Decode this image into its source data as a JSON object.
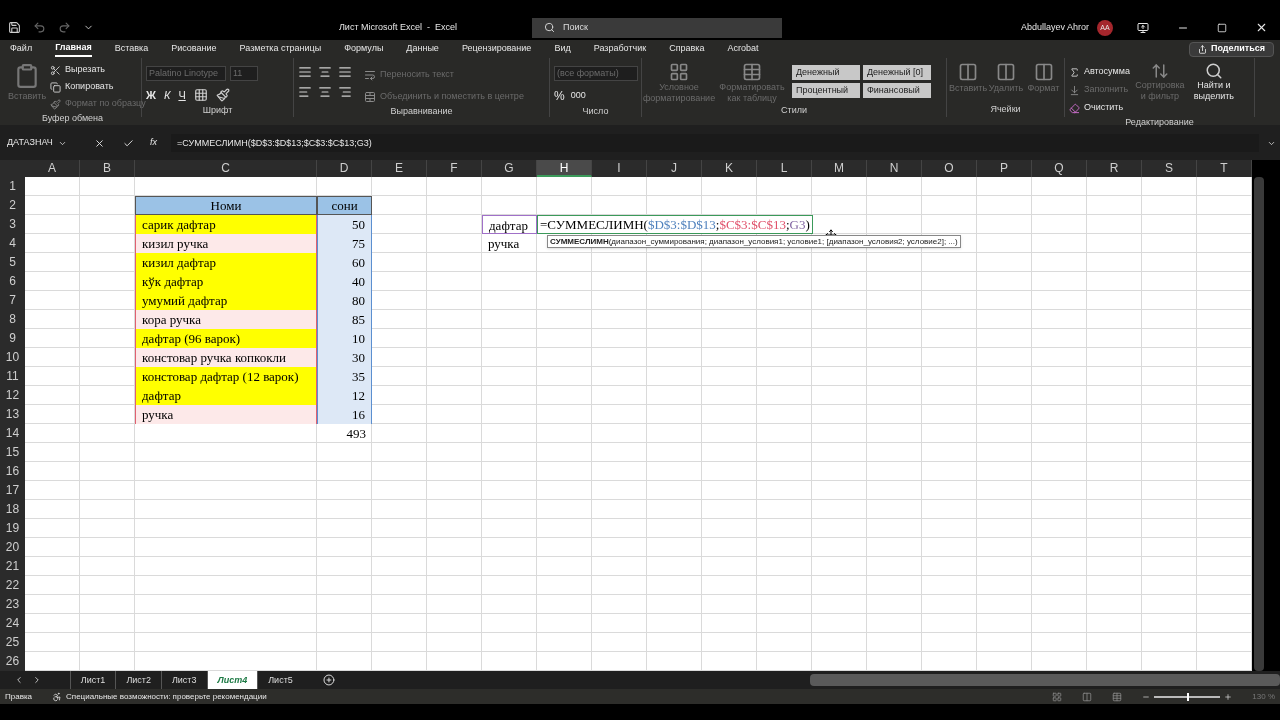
{
  "window": {
    "title": "Лист Microsoft Excel  -  Excel",
    "search_placeholder": "Поиск",
    "user": "Abdullayev Ahror",
    "avatar": "AA"
  },
  "ribbon_tabs": [
    {
      "label": "Файл",
      "selected": false
    },
    {
      "label": "Главная",
      "selected": true
    },
    {
      "label": "Вставка",
      "selected": false
    },
    {
      "label": "Рисование",
      "selected": false
    },
    {
      "label": "Разметка страницы",
      "selected": false
    },
    {
      "label": "Формулы",
      "selected": false
    },
    {
      "label": "Данные",
      "selected": false
    },
    {
      "label": "Рецензирование",
      "selected": false
    },
    {
      "label": "Вид",
      "selected": false
    },
    {
      "label": "Разработчик",
      "selected": false
    },
    {
      "label": "Справка",
      "selected": false
    },
    {
      "label": "Acrobat",
      "selected": false
    }
  ],
  "share_button": "Поделиться",
  "clipboard": {
    "label": "Буфер обмена",
    "paste": {
      "label": "Вставить",
      "disabled": true
    },
    "cut": {
      "label": "Вырезать",
      "disabled": false
    },
    "copy": {
      "label": "Копировать",
      "disabled": false
    },
    "format_painter": {
      "label": "Формат по образцу",
      "disabled": true
    }
  },
  "font": {
    "label": "Шрифт",
    "family": "Palatino Linotype",
    "size": "11",
    "bold": "Ж",
    "italic": "К",
    "underline": "Ч"
  },
  "alignment": {
    "label": "Выравнивание",
    "wrap": {
      "label": "Переносить текст",
      "disabled": true
    },
    "merge": {
      "label": "Объединить и поместить в центре",
      "disabled": true
    }
  },
  "number": {
    "label": "Число",
    "format": "(все форматы)",
    "percent": "%",
    "thousands": "000"
  },
  "styles": {
    "label": "Стили",
    "conditional": "Условное форматирование",
    "as_table": "Форматировать как таблицу",
    "chips": [
      "Денежный",
      "Денежный [0]",
      "Процентный",
      "Финансовый"
    ]
  },
  "cells": {
    "label": "Ячейки",
    "items": [
      "Вставить",
      "Удалить",
      "Формат"
    ]
  },
  "editing": {
    "label": "Редактирование",
    "autosum": {
      "label": "Автосумма",
      "disabled": false
    },
    "fill": {
      "label": "Заполнить",
      "disabled": true
    },
    "clear": {
      "label": "Очистить",
      "disabled": false
    },
    "sort": {
      "label": "Сортировка и фильтр",
      "disabled": true
    },
    "find": {
      "label": "Найти и выделить",
      "disabled": false
    }
  },
  "formula_bar": {
    "name_box": "ДАТАЗНАЧ",
    "fx": "fx",
    "formula": "=СУММЕСЛИМН($D$3:$D$13;$C$3:$C$13;G3)"
  },
  "columns": [
    {
      "label": "A",
      "selected": false
    },
    {
      "label": "B",
      "selected": false
    },
    {
      "label": "C",
      "selected": false
    },
    {
      "label": "D",
      "selected": false
    },
    {
      "label": "E",
      "selected": false
    },
    {
      "label": "F",
      "selected": false
    },
    {
      "label": "G",
      "selected": false
    },
    {
      "label": "H",
      "selected": true
    },
    {
      "label": "I",
      "selected": false
    },
    {
      "label": "J",
      "selected": false
    },
    {
      "label": "K",
      "selected": false
    },
    {
      "label": "L",
      "selected": false
    },
    {
      "label": "M",
      "selected": false
    },
    {
      "label": "N",
      "selected": false
    },
    {
      "label": "O",
      "selected": false
    },
    {
      "label": "P",
      "selected": false
    },
    {
      "label": "Q",
      "selected": false
    },
    {
      "label": "R",
      "selected": false
    },
    {
      "label": "S",
      "selected": false
    },
    {
      "label": "T",
      "selected": false
    }
  ],
  "row_numbers": [
    "1",
    "2",
    "3",
    "4",
    "5",
    "6",
    "7",
    "8",
    "9",
    "10",
    "11",
    "12",
    "13",
    "14",
    "15",
    "16",
    "17",
    "18",
    "19",
    "20",
    "21",
    "22",
    "23",
    "24",
    "25",
    "26"
  ],
  "table": {
    "columns": [
      "Номи",
      "сони"
    ],
    "rows": [
      {
        "name": "сарик дафтар",
        "count": "50",
        "highlighted": true
      },
      {
        "name": "кизил ручка",
        "count": "75",
        "highlighted": false
      },
      {
        "name": "кизил дафтар",
        "count": "60",
        "highlighted": true
      },
      {
        "name": "кўк дафтар",
        "count": "40",
        "highlighted": true
      },
      {
        "name": "умумий дафтар",
        "count": "80",
        "highlighted": true
      },
      {
        "name": "кора ручка",
        "count": "85",
        "highlighted": false
      },
      {
        "name": "дафтар (96 варок)",
        "count": "10",
        "highlighted": true
      },
      {
        "name": "констовар ручка копкокли",
        "count": "30",
        "highlighted": false
      },
      {
        "name": "констовар дафтар (12 варок)",
        "count": "35",
        "highlighted": true
      },
      {
        "name": "дафтар",
        "count": "12",
        "highlighted": true
      },
      {
        "name": "ручка",
        "count": "16",
        "highlighted": false
      }
    ],
    "total": "493"
  },
  "criteria": [
    "дафтар",
    "ручка"
  ],
  "cell_editor": [
    {
      "text": "=СУММЕСЛИМН("
    },
    {
      "text": "$D$3:$D$13",
      "color": "#4f81bd"
    },
    {
      "text": ";"
    },
    {
      "text": "$C$3:$C$13",
      "color": "#e0506a"
    },
    {
      "text": ";"
    },
    {
      "text": "G3",
      "color": "#8064a2"
    },
    {
      "text": ")"
    }
  ],
  "tooltip": "**СУММЕСЛИМН**(диапазон_суммирования; диапазон_условия1; условие1; [диапазон_условия2; условие2]; ...)",
  "sheet_tabs": [
    {
      "label": "Лист1",
      "selected": false
    },
    {
      "label": "Лист2",
      "selected": false
    },
    {
      "label": "Лист3",
      "selected": false
    },
    {
      "label": "Лист4",
      "selected": true
    },
    {
      "label": "Лист5",
      "selected": false
    }
  ],
  "status_bar": {
    "mode": "Правка",
    "accessibility": "Специальные возможности: проверьте рекомендации",
    "zoom": "130 %",
    "zoom_slider": {
      "level": 0.5
    }
  }
}
